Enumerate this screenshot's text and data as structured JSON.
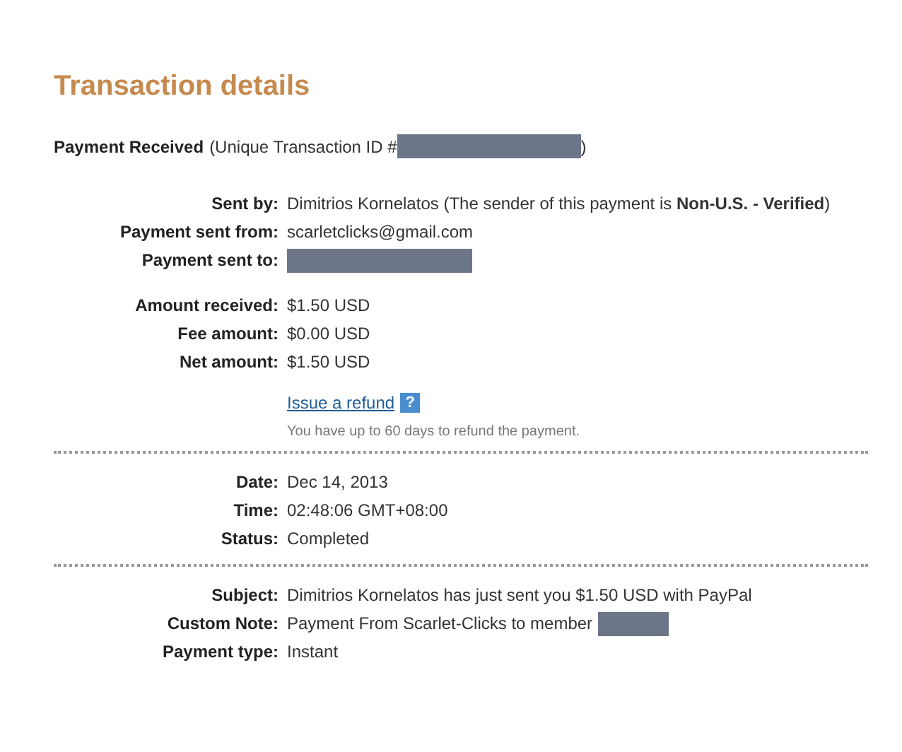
{
  "title": "Transaction details",
  "header": {
    "heading": "Payment Received",
    "text": "(Unique Transaction ID #",
    "redacted": true,
    "closing": ")"
  },
  "sections": [
    {
      "groups": [
        {
          "rows": [
            {
              "label": "Sent by:",
              "kind": "text",
              "value": "Dimitrios Kornelatos (The sender of this payment is **Non-U.S. - Verified**)"
            },
            {
              "label": "Payment sent from:",
              "kind": "text",
              "value": "scarletclicks@gmail.com"
            },
            {
              "label": "Payment sent to:",
              "kind": "redacted"
            }
          ]
        },
        {
          "rows": [
            {
              "label": "Amount received:",
              "kind": "text",
              "value": "$1.50 USD"
            },
            {
              "label": "Fee amount:",
              "kind": "text",
              "value": "$0.00 USD"
            },
            {
              "label": "Net amount:",
              "kind": "text",
              "value": "$1.50 USD"
            }
          ]
        }
      ],
      "refund": {
        "link": "Issue a refund",
        "help": "?",
        "note": "You have up to 60 days to refund the payment."
      }
    },
    {
      "groups": [
        {
          "rows": [
            {
              "label": "Date:",
              "kind": "text",
              "value": "Dec 14, 2013"
            },
            {
              "label": "Time:",
              "kind": "text",
              "value": "02:48:06 GMT+08:00"
            },
            {
              "label": "Status:",
              "kind": "text",
              "value": "Completed"
            }
          ]
        }
      ]
    },
    {
      "groups": [
        {
          "rows": [
            {
              "label": "Subject:",
              "kind": "text",
              "value": "Dimitrios Kornelatos has just sent you $1.50 USD with PayPal"
            },
            {
              "label": "Custom Note:",
              "kind": "text_redacted",
              "value": "Payment From Scarlet-Clicks to member"
            },
            {
              "label": "Payment type:",
              "kind": "text",
              "value": "Instant"
            }
          ]
        }
      ]
    }
  ]
}
